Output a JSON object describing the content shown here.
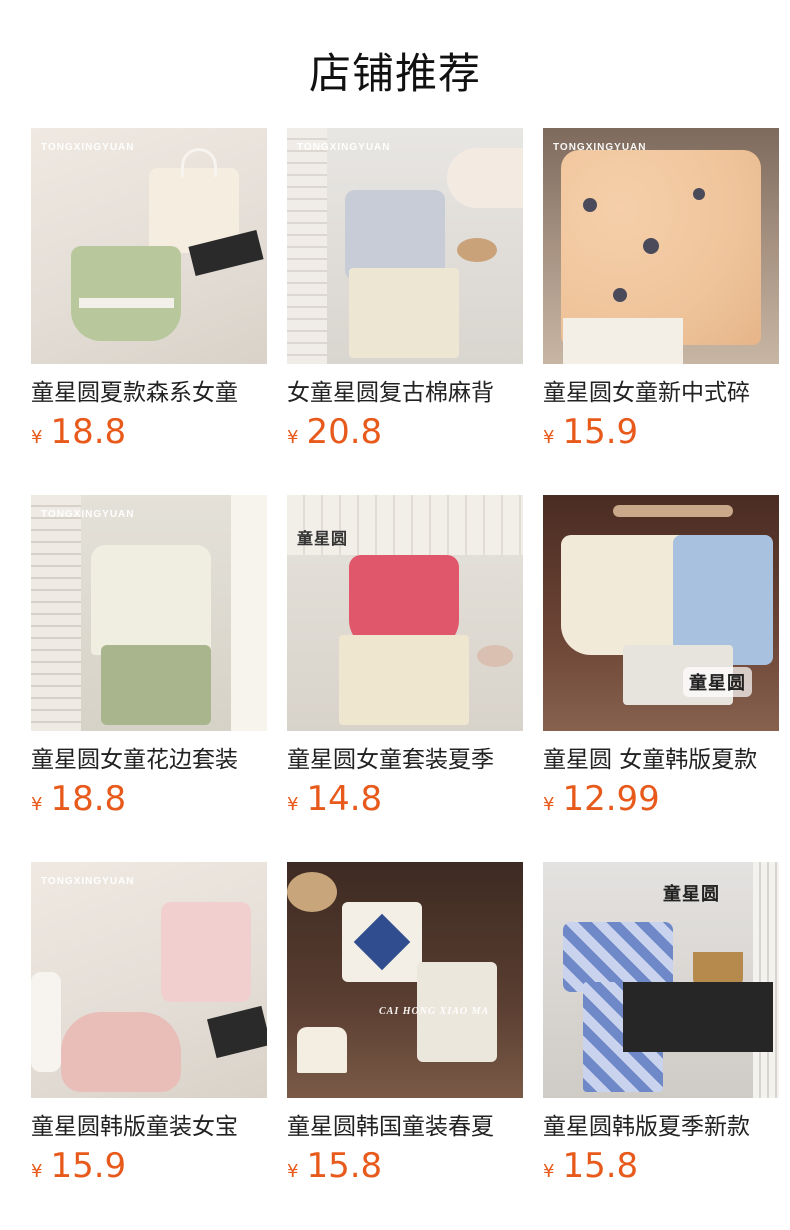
{
  "header": {
    "title": "店铺推荐"
  },
  "currency_symbol": "¥",
  "products": [
    {
      "title": "童星圆夏款森系女童",
      "price": "18.8",
      "brand": "TONGXINGYUAN"
    },
    {
      "title": "女童星圆复古棉麻背",
      "price": "20.8",
      "brand": "TONGXINGYUAN"
    },
    {
      "title": "童星圆女童新中式碎",
      "price": "15.9",
      "brand": "TONGXINGYUAN"
    },
    {
      "title": "童星圆女童花边套装",
      "price": "18.8",
      "brand": "TONGXINGYUAN"
    },
    {
      "title": "童星圆女童套装夏季",
      "price": "14.8",
      "brand": "童星圆"
    },
    {
      "title": "童星圆 女童韩版夏款",
      "price": "12.99",
      "brand": "童星圆"
    },
    {
      "title": "童星圆韩版童装女宝",
      "price": "15.9",
      "brand": "TONGXINGYUAN"
    },
    {
      "title": "童星圆韩国童装春夏",
      "price": "15.8",
      "brand": "CAI HONG XIAO MA"
    },
    {
      "title": "童星圆韩版夏季新款",
      "price": "15.8",
      "brand": "童星圆"
    }
  ],
  "colors": {
    "price": "#e85a1b",
    "title": "#222222"
  }
}
